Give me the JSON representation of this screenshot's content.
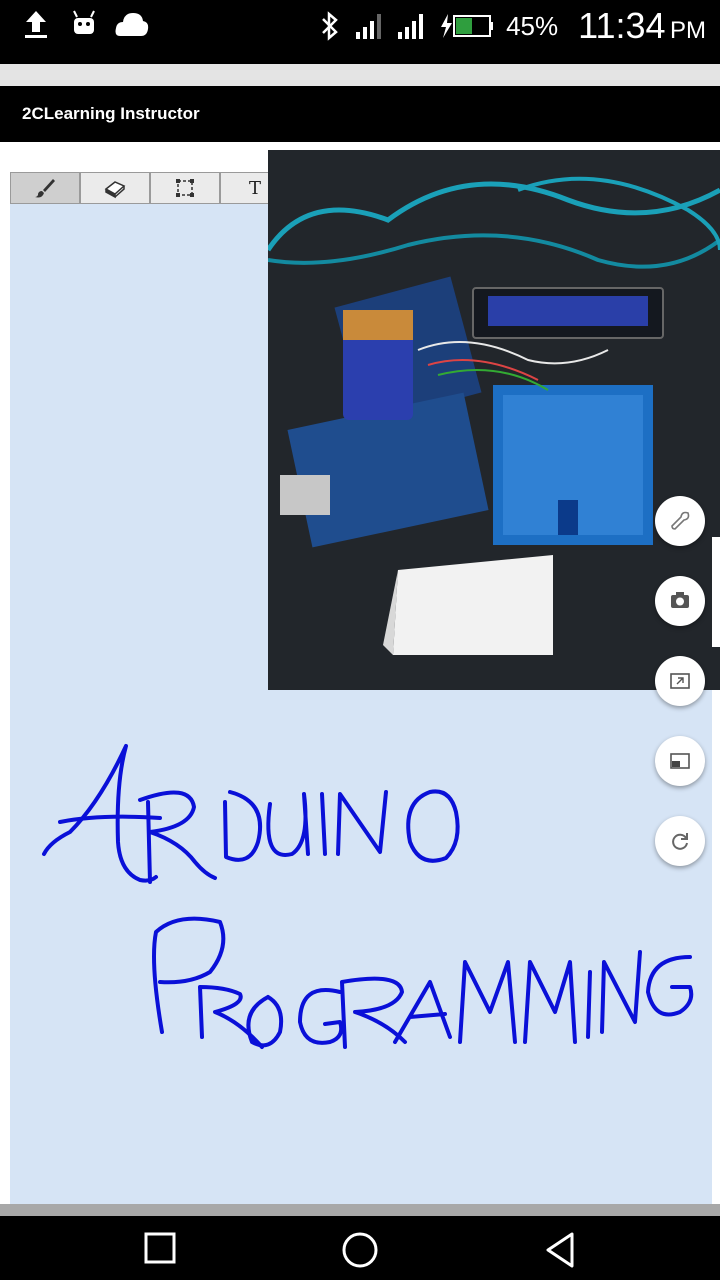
{
  "status_bar": {
    "battery_percent": "45%",
    "time": "11:34",
    "ampm": "PM",
    "icons": [
      "upload-icon",
      "android-icon",
      "cloud-icon",
      "bluetooth-icon",
      "signal-icon",
      "signal-icon",
      "battery-charging-icon"
    ]
  },
  "app": {
    "title": "2CLearning Instructor"
  },
  "toolbar": {
    "tools": [
      {
        "name": "brush",
        "icon": "brush-icon",
        "active": true
      },
      {
        "name": "eraser",
        "icon": "eraser-icon",
        "active": false
      },
      {
        "name": "select",
        "icon": "selection-icon",
        "active": false
      },
      {
        "name": "text",
        "label": "T",
        "active": false
      }
    ]
  },
  "canvas": {
    "handwriting_line1": "ARDUINO",
    "handwriting_line2": "PROGRAMMING",
    "ink_color": "#0a10d8",
    "background_color": "#d6e4f5"
  },
  "side_buttons": [
    "wrench-icon",
    "camera-switch-icon",
    "minimize-window-icon",
    "pip-icon",
    "refresh-icon"
  ],
  "nav_bar": [
    "recents-icon",
    "home-icon",
    "back-icon"
  ]
}
